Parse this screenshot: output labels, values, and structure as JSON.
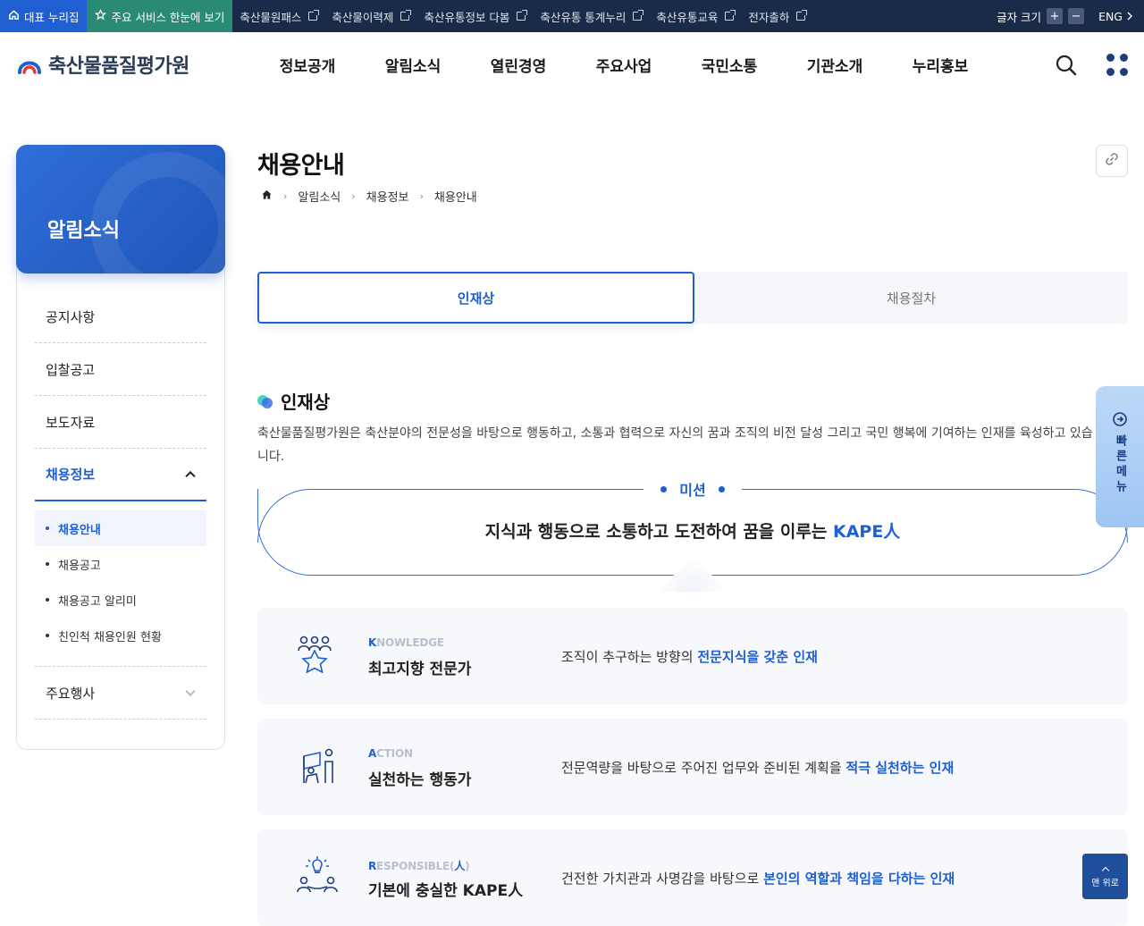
{
  "topbar": {
    "main_portal": "대표 누리집",
    "service_view": "주요 서비스 한눈에 보기",
    "links": [
      "축산물원패스",
      "축산물이력제",
      "축산유통정보 다봄",
      "축산유통 통계누리",
      "축산유통교육",
      "전자출하"
    ],
    "font_size_label": "글자 크기",
    "font_plus": "+",
    "font_minus": "−",
    "lang": "ENG"
  },
  "header": {
    "logo_text": "축산물품질평가원",
    "gnb": [
      "정보공개",
      "알림소식",
      "열린경영",
      "주요사업",
      "국민소통",
      "기관소개",
      "누리홍보"
    ]
  },
  "lnb": {
    "title": "알림소식",
    "items": [
      {
        "label": "공지사항"
      },
      {
        "label": "입찰공고"
      },
      {
        "label": "보도자료"
      },
      {
        "label": "채용정보"
      },
      {
        "label": "주요행사"
      }
    ],
    "sub_items": [
      "채용안내",
      "채용공고",
      "채용공고 알리미",
      "친인척 채용인원 현황"
    ]
  },
  "page": {
    "title": "채용안내",
    "breadcrumb": [
      "알림소식",
      "채용정보",
      "채용안내"
    ]
  },
  "tabs": [
    "인재상",
    "채용절차"
  ],
  "section": {
    "title": "인재상",
    "description": "축산물품질평가원은 축산분야의 전문성을 바탕으로 행동하고, 소통과 협력으로 자신의 꿈과 조직의 비전 달성 그리고 국민 행복에 기여하는 인재를 육성하고 있습니다."
  },
  "mission": {
    "label": "미션",
    "text": "지식과 행동으로 소통하고 도전하여 꿈을 이루는 ",
    "accent": "KAPE人"
  },
  "cards": [
    {
      "eng_first": "K",
      "eng_rest": "NOWLEDGE",
      "name": "최고지향 전문가",
      "desc_pre": "조직이 추구하는 방향의 ",
      "desc_hl": "전문지식을 갖춘 인재",
      "icon": "people-star-icon"
    },
    {
      "eng_first": "A",
      "eng_rest": "CTION",
      "name": "실천하는 행동가",
      "desc_pre": "전문역량을 바탕으로 주어진 업무와 준비된 계획을 ",
      "desc_hl": "적극 실천하는 인재",
      "icon": "action-flag-icon"
    },
    {
      "eng_first": "R",
      "eng_rest": "ESPONSIBLE(",
      "eng_han": "人",
      "eng_close": ")",
      "name": "기본에 충실한 KAPE人",
      "desc_pre": "건전한 가치관과 사명감을 바탕으로 ",
      "desc_hl": "본인의 역할과 책임을 다하는 인재",
      "icon": "idea-people-icon"
    }
  ],
  "quick_menu": {
    "label": "빠른메뉴"
  },
  "go_top": {
    "label": "맨 위로"
  },
  "colors": {
    "primary": "#1f5fd1",
    "topbar": "#1a2b4a",
    "service": "#2a8a73"
  }
}
